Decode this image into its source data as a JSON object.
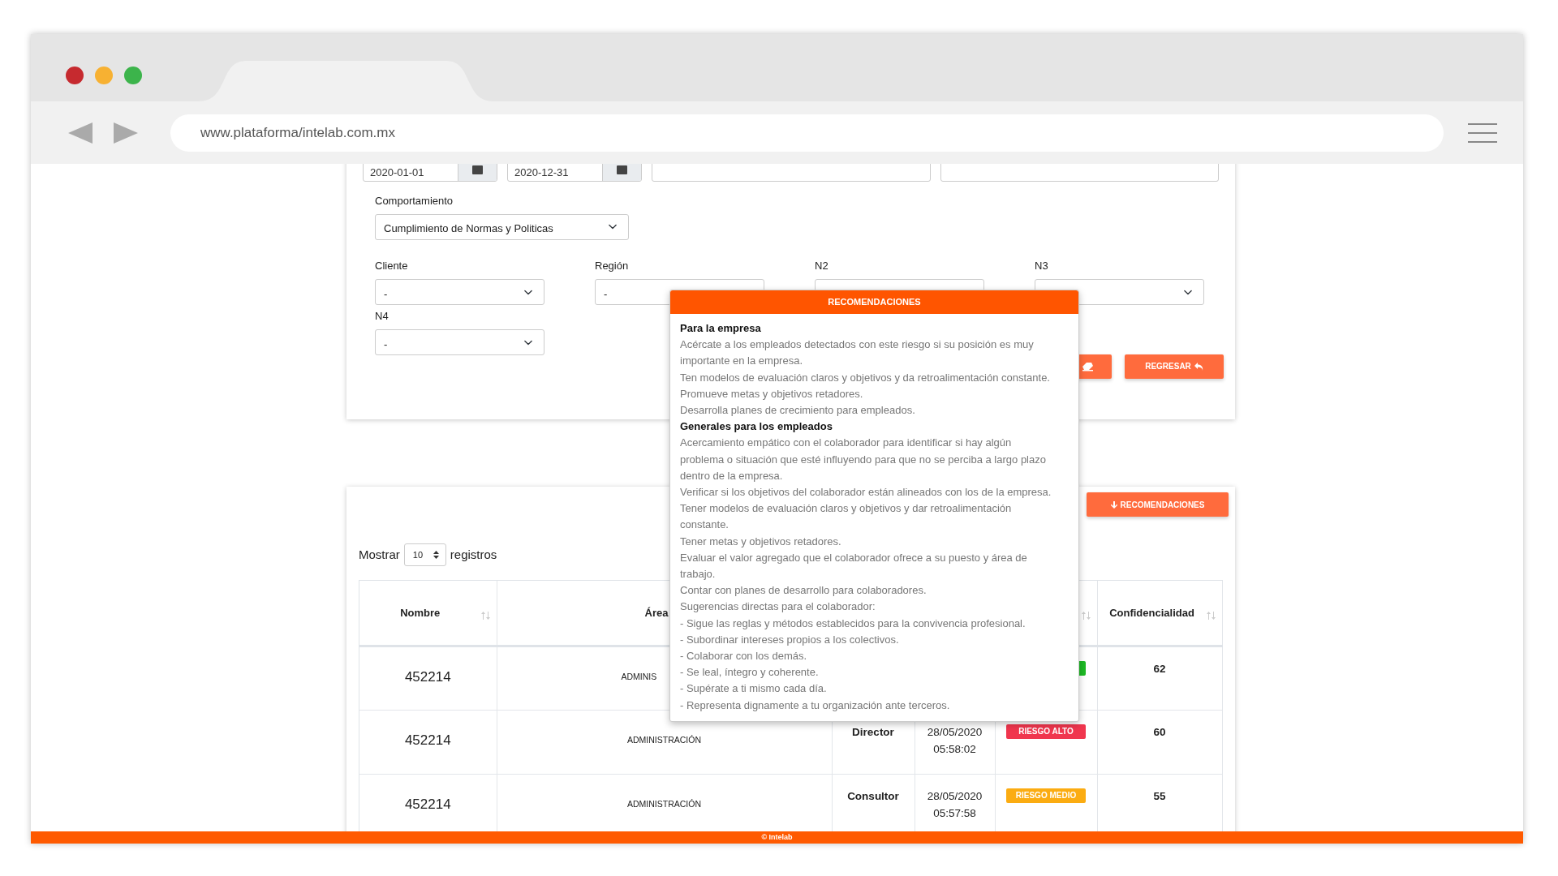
{
  "browser": {
    "url": "www.plataforma/intelab.com.mx"
  },
  "filters": {
    "dates": [
      "2020-01-01",
      "2020-12-31"
    ],
    "behavior": {
      "label": "Comportamiento",
      "value": "Cumplimiento de Normas y Politicas"
    },
    "selects": [
      {
        "label": "Cliente",
        "value": "-"
      },
      {
        "label": "Región",
        "value": "-"
      },
      {
        "label": "N2"
      },
      {
        "label": "N3"
      },
      {
        "label": "N4",
        "value": "-"
      }
    ],
    "buttons": [
      {
        "kind": "clear"
      },
      {
        "kind": "back",
        "label": "REGRESAR"
      }
    ]
  },
  "recommend_button": {
    "label": "RECOMENDACIONES"
  },
  "popover": {
    "title": "RECOMENDACIONES",
    "sections": [
      {
        "heading": "Para la empresa",
        "lines": [
          "Acércate a los empleados detectados con este riesgo si su posición es muy importante en la empresa.",
          "Ten modelos de evaluación claros y objetivos y da retroalimentación constante.",
          "Promueve metas y objetivos retadores.",
          "Desarrolla planes de crecimiento para empleados."
        ]
      },
      {
        "heading": "Generales para los empleados",
        "lines": [
          "Acercamiento empático con el colaborador para identificar si hay algún problema o situación que esté influyendo para que no se perciba a largo plazo dentro de la empresa.",
          "Verificar si los objetivos del colaborador están alineados con los de la empresa.",
          "Tener modelos de evaluación claros y objetivos y dar retroalimentación constante.",
          "Tener metas y objetivos retadores.",
          "Evaluar el valor agregado que el colaborador ofrece a su puesto y área de trabajo.",
          "Contar con planes de desarrollo para colaboradores.",
          "Sugerencias directas para el colaborador:",
          "- Sigue las reglas y métodos establecidos para la convivencia profesional.",
          "- Subordinar intereses propios a los colectivos.",
          "- Colaborar con los demás.",
          "- Se leal, íntegro y coherente.",
          "- Supérate a ti mismo cada día.",
          "- Representa dignamente a tu organización ante terceros."
        ]
      }
    ]
  },
  "table": {
    "length": {
      "before": "Mostrar",
      "value": "10",
      "after": "registros"
    },
    "columns": [
      {
        "label": "Nombre",
        "sort_icon": true
      },
      {
        "label": "Área"
      },
      {},
      {},
      {
        "sort_icon": true
      },
      {
        "label": "Confidencialidad",
        "sort_icon": true
      }
    ],
    "rows": [
      {
        "name": "452214",
        "area": "ADMINIS",
        "area_cut": true,
        "risk": {
          "color": "#1db924"
        },
        "confidentiality": "62"
      },
      {
        "name": "452214",
        "area": "ADMINISTRACIÓN",
        "area_cut": false,
        "position": "Director",
        "date": "28/05/2020",
        "time": "05:58:02",
        "risk": {
          "label": "RIESGO ALTO",
          "color": "#f0364e"
        },
        "confidentiality": "60"
      },
      {
        "name": "452214",
        "area": "ADMINISTRACIÓN",
        "area_cut": false,
        "position": "Consultor",
        "date": "28/05/2020",
        "time": "05:57:58",
        "risk": {
          "label": "RIESGO MEDIO",
          "color": "#fbac12"
        },
        "confidentiality": "55"
      }
    ]
  },
  "footer": {
    "text": "© Intelab"
  }
}
